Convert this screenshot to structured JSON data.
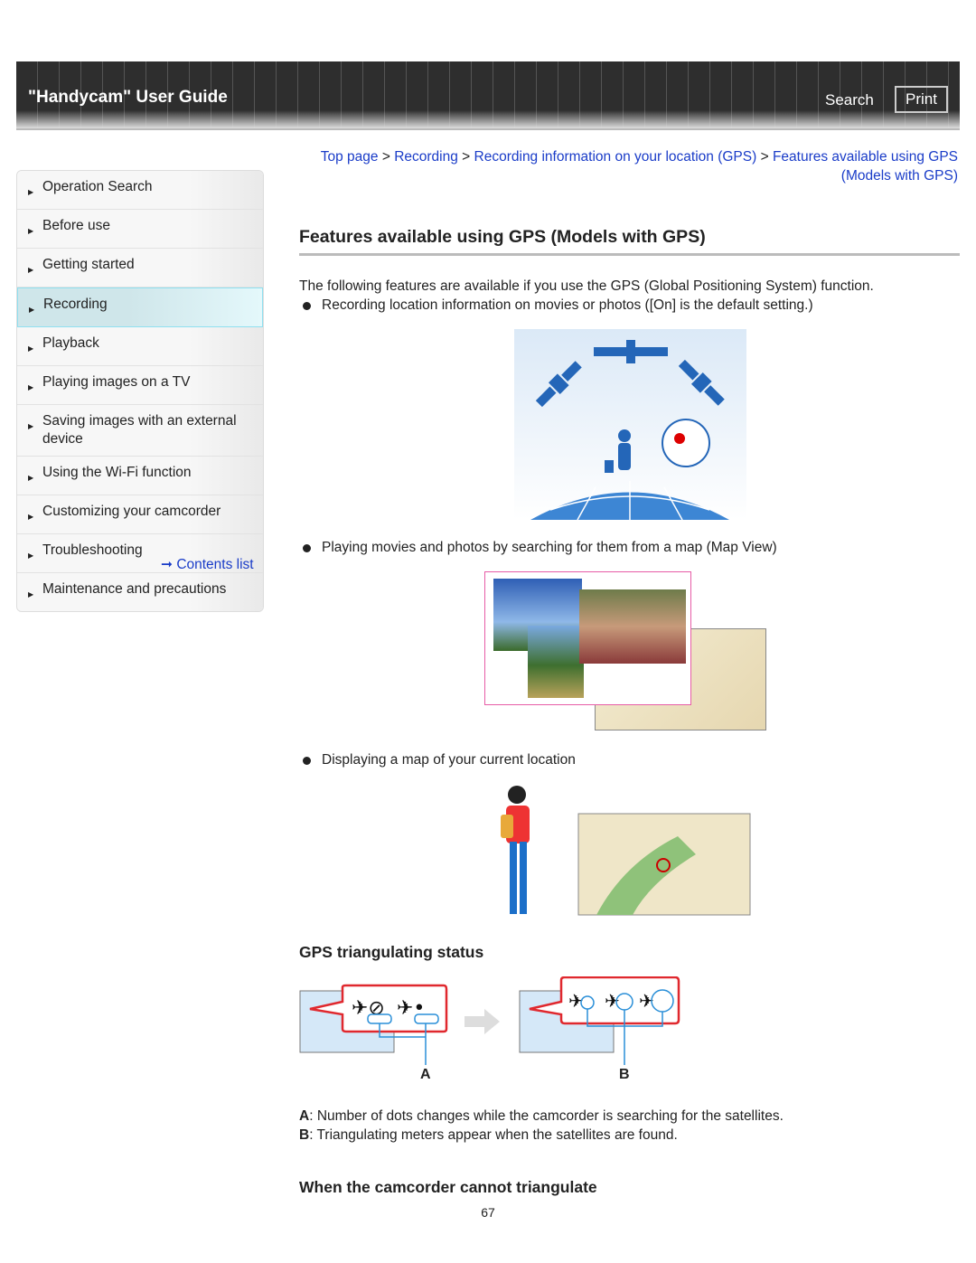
{
  "header": {
    "title": "\"Handycam\" User Guide",
    "search": "Search",
    "print": "Print"
  },
  "sidebar": {
    "items": [
      {
        "label": "Operation Search"
      },
      {
        "label": "Before use"
      },
      {
        "label": "Getting started"
      },
      {
        "label": "Recording",
        "active": true
      },
      {
        "label": "Playback"
      },
      {
        "label": "Playing images on a TV"
      },
      {
        "label": "Saving images with an external device"
      },
      {
        "label": "Using the Wi-Fi function"
      },
      {
        "label": "Customizing your camcorder"
      },
      {
        "label": "Troubleshooting"
      },
      {
        "label": "Maintenance and precautions"
      }
    ],
    "contents_link": "Contents list"
  },
  "breadcrumb": {
    "items": [
      "Top page",
      "Recording",
      "Recording information on your location (GPS)",
      "Features available using GPS (Models with GPS)"
    ],
    "separator": " > "
  },
  "page": {
    "title": "Features available using GPS (Models with GPS)",
    "intro": "The following features are available if you use the GPS (Global Positioning System) function.",
    "bullets": [
      "Recording location information on movies or photos ([On] is the default setting.)",
      "Playing movies and photos by searching for them from a map (Map View)",
      "Displaying a map of your current location"
    ],
    "section1": "GPS triangulating status",
    "diagram": {
      "label_a": "A",
      "label_b": "B"
    },
    "desc_a_key": "A",
    "desc_a": ": Number of dots changes while the camcorder is searching for the satellites.",
    "desc_b_key": "B",
    "desc_b": ": Triangulating meters appear when the satellites are found.",
    "section2": "When the camcorder cannot triangulate",
    "page_number": "67"
  },
  "colors": {
    "link": "#1a3cc8",
    "active_nav": "#cfe6ea",
    "callout_red": "#e0282e",
    "diagram_blue": "#2a8fd8"
  }
}
